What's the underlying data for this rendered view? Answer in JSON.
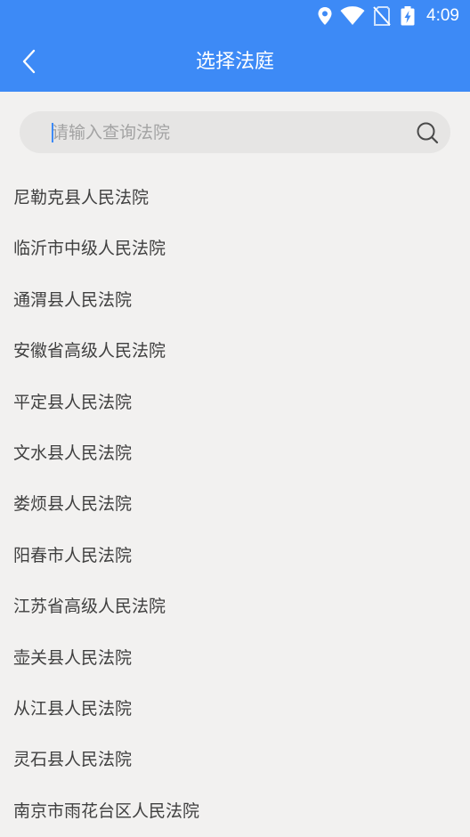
{
  "status_bar": {
    "time": "4:09",
    "icons": [
      "location-icon",
      "wifi-icon",
      "no-sim-icon",
      "battery-charging-icon"
    ]
  },
  "nav": {
    "title": "选择法庭",
    "back_icon": "chevron-left-icon"
  },
  "search": {
    "placeholder": "请输入查询法院",
    "value": "",
    "icon": "search-icon"
  },
  "courts": [
    "尼勒克县人民法院",
    "临沂市中级人民法院",
    "通渭县人民法院",
    "安徽省高级人民法院",
    "平定县人民法院",
    "文水县人民法院",
    "娄烦县人民法院",
    "阳春市人民法院",
    "江苏省高级人民法院",
    "壶关县人民法院",
    "从江县人民法院",
    "灵石县人民法院",
    "南京市雨花台区人民法院"
  ],
  "colors": {
    "brand": "#3d8af6",
    "background": "#f2f1f0",
    "search_background": "#e6e5e4",
    "text": "#404040",
    "placeholder": "#a3a3a3"
  }
}
